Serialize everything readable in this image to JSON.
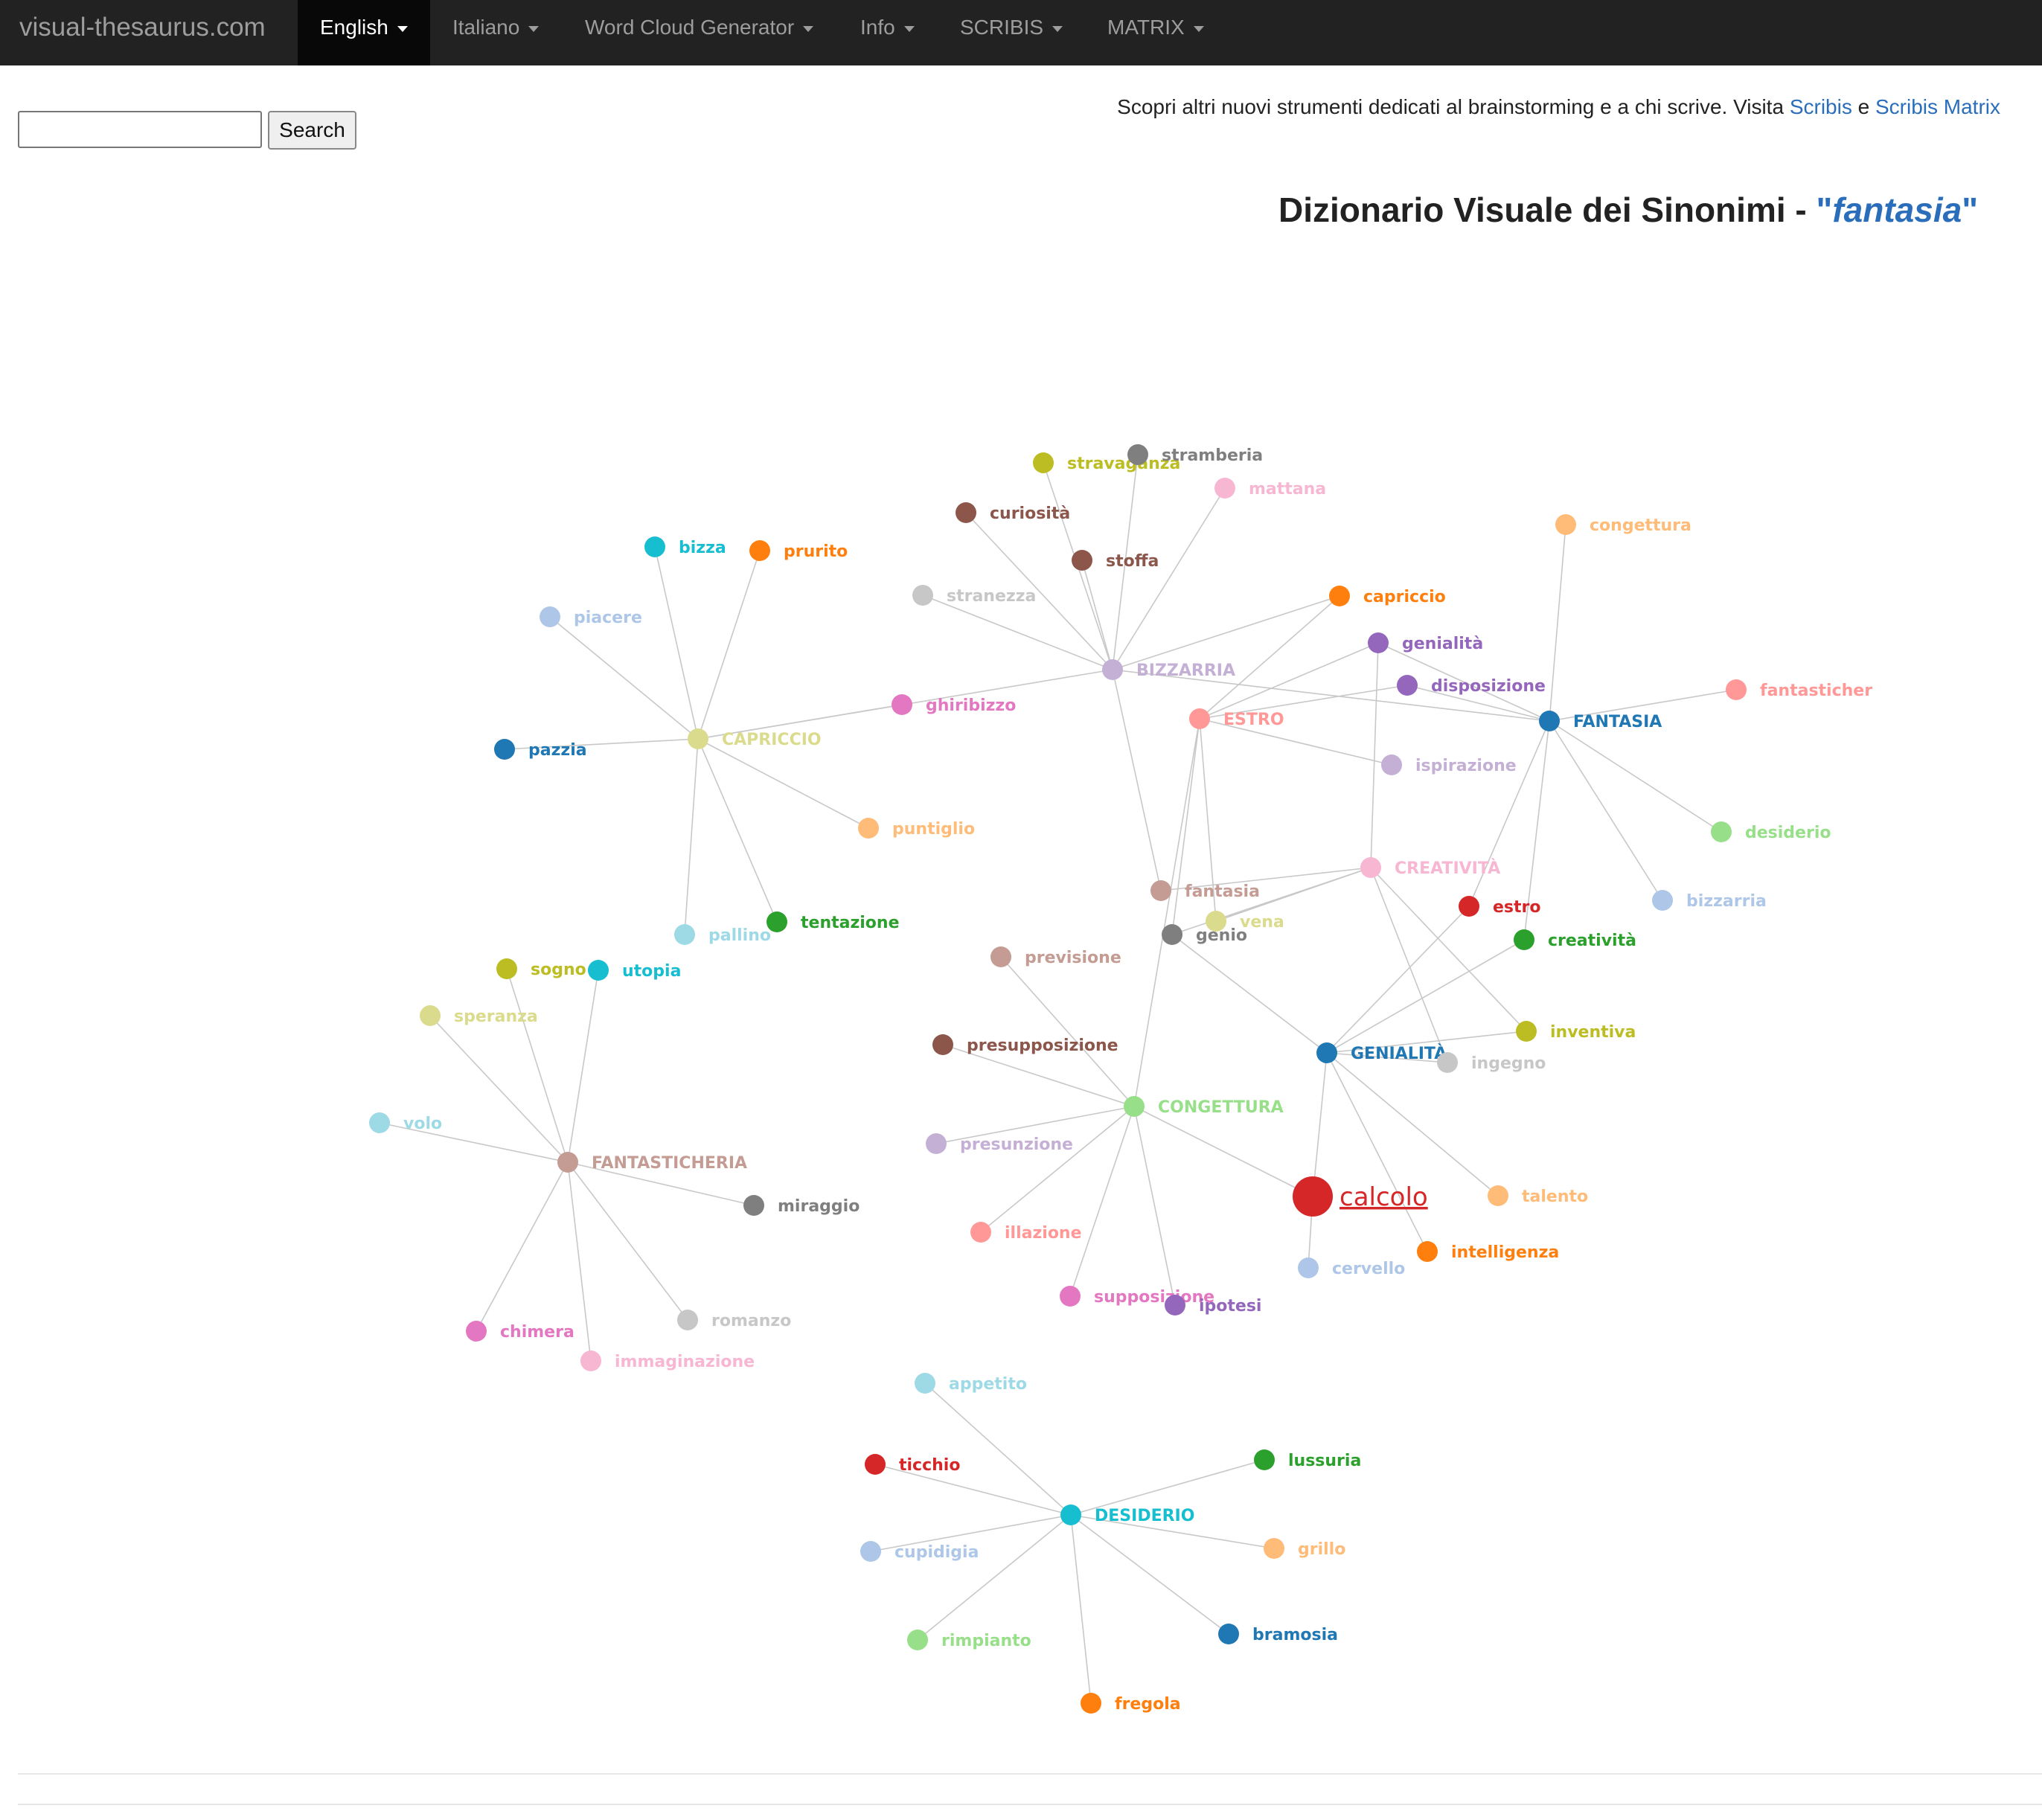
{
  "navbar": {
    "brand": "visual-thesaurus.com",
    "items": [
      {
        "label": "English",
        "active": true
      },
      {
        "label": "Italiano"
      },
      {
        "label": "Word Cloud Generator"
      },
      {
        "label": "Info"
      },
      {
        "label": "SCRIBIS"
      },
      {
        "label": "MATRIX"
      }
    ]
  },
  "search": {
    "value": "",
    "button_label": "Search"
  },
  "promo": {
    "text": "Scopri altri nuovi strumenti dedicati al brainstorming e a chi scrive. Visita",
    "link1": "Scribis",
    "conj": "e",
    "link2": "Scribis Matrix"
  },
  "page_title": {
    "prefix": "Dizionario Visuale dei Sinonimi - ",
    "quote_open": "\"",
    "keyword": "fantasia",
    "quote_close": "\""
  },
  "graph": {
    "nodes": [
      {
        "id": "CAPRICCIO",
        "color": "#dbdb8d",
        "hub": true
      },
      {
        "id": "BIZZARRIA",
        "color": "#c5b0d5",
        "hub": true
      },
      {
        "id": "ESTRO",
        "color": "#ff9896",
        "hub": true
      },
      {
        "id": "FANTASIA",
        "color": "#1f77b4",
        "hub": true
      },
      {
        "id": "CREATIVITÀ",
        "color": "#f7b6d2",
        "hub": true
      },
      {
        "id": "GENIALITÀ",
        "color": "#1f77b4",
        "hub": true
      },
      {
        "id": "CONGETTURA",
        "color": "#98df8a",
        "hub": true
      },
      {
        "id": "FANTASTICHERIA",
        "color": "#c49c94",
        "hub": true
      },
      {
        "id": "DESIDERIO",
        "color": "#17becf",
        "hub": true
      },
      {
        "id": "calcolo",
        "color": "#d62728",
        "center": true
      },
      {
        "id": "stravaganza",
        "color": "#bcbd22"
      },
      {
        "id": "stramberia",
        "color": "#7f7f7f"
      },
      {
        "id": "mattana",
        "color": "#f7b6d2"
      },
      {
        "id": "curiosità",
        "color": "#8c564b"
      },
      {
        "id": "stoffa",
        "color": "#8c564b"
      },
      {
        "id": "stranezza",
        "color": "#c7c7c7"
      },
      {
        "id": "bizza",
        "color": "#17becf"
      },
      {
        "id": "prurito",
        "color": "#ff7f0e"
      },
      {
        "id": "piacere",
        "color": "#aec7e8"
      },
      {
        "id": "ghiribizzo",
        "color": "#e377c2"
      },
      {
        "id": "pazzia",
        "color": "#1f77b4"
      },
      {
        "id": "puntiglio",
        "color": "#ffbb78"
      },
      {
        "id": "pallino",
        "color": "#9edae5"
      },
      {
        "id": "tentazione",
        "color": "#2ca02c"
      },
      {
        "id": "capriccio",
        "color": "#ff7f0e"
      },
      {
        "id": "genialità",
        "color": "#9467bd"
      },
      {
        "id": "disposizione",
        "color": "#9467bd"
      },
      {
        "id": "ispirazione",
        "color": "#c5b0d5"
      },
      {
        "id": "congettura",
        "color": "#ffbb78"
      },
      {
        "id": "fantasticher",
        "color": "#ff9896"
      },
      {
        "id": "desiderio",
        "color": "#98df8a"
      },
      {
        "id": "bizzarria",
        "color": "#aec7e8"
      },
      {
        "id": "estro",
        "color": "#d62728"
      },
      {
        "id": "creatività",
        "color": "#2ca02c"
      },
      {
        "id": "fantasia",
        "color": "#c49c94"
      },
      {
        "id": "vena",
        "color": "#dbdb8d"
      },
      {
        "id": "genio",
        "color": "#7f7f7f"
      },
      {
        "id": "previsione",
        "color": "#c49c94"
      },
      {
        "id": "inventiva",
        "color": "#bcbd22"
      },
      {
        "id": "ingegno",
        "color": "#c7c7c7"
      },
      {
        "id": "presupposizione",
        "color": "#8c564b"
      },
      {
        "id": "presunzione",
        "color": "#c5b0d5"
      },
      {
        "id": "talento",
        "color": "#ffbb78"
      },
      {
        "id": "illazione",
        "color": "#ff9896"
      },
      {
        "id": "intelligenza",
        "color": "#ff7f0e"
      },
      {
        "id": "cervello",
        "color": "#aec7e8"
      },
      {
        "id": "supposizione",
        "color": "#e377c2"
      },
      {
        "id": "ipotesi",
        "color": "#9467bd"
      },
      {
        "id": "sogno",
        "color": "#bcbd22"
      },
      {
        "id": "utopia",
        "color": "#17becf"
      },
      {
        "id": "speranza",
        "color": "#dbdb8d"
      },
      {
        "id": "volo",
        "color": "#9edae5"
      },
      {
        "id": "miraggio",
        "color": "#7f7f7f"
      },
      {
        "id": "chimera",
        "color": "#e377c2"
      },
      {
        "id": "romanzo",
        "color": "#c7c7c7"
      },
      {
        "id": "immaginazione",
        "color": "#f7b6d2"
      },
      {
        "id": "appetito",
        "color": "#9edae5"
      },
      {
        "id": "ticchio",
        "color": "#d62728"
      },
      {
        "id": "lussuria",
        "color": "#2ca02c"
      },
      {
        "id": "cupidigia",
        "color": "#aec7e8"
      },
      {
        "id": "grillo",
        "color": "#ffbb78"
      },
      {
        "id": "rimpianto",
        "color": "#98df8a"
      },
      {
        "id": "bramosia",
        "color": "#1f77b4"
      },
      {
        "id": "fregola",
        "color": "#ff7f0e"
      }
    ],
    "links": [
      [
        "CAPRICCIO",
        "bizza"
      ],
      [
        "CAPRICCIO",
        "prurito"
      ],
      [
        "CAPRICCIO",
        "piacere"
      ],
      [
        "CAPRICCIO",
        "pazzia"
      ],
      [
        "CAPRICCIO",
        "ghiribizzo"
      ],
      [
        "CAPRICCIO",
        "puntiglio"
      ],
      [
        "CAPRICCIO",
        "pallino"
      ],
      [
        "CAPRICCIO",
        "tentazione"
      ],
      [
        "CAPRICCIO",
        "BIZZARRIA"
      ],
      [
        "BIZZARRIA",
        "stravaganza"
      ],
      [
        "BIZZARRIA",
        "stramberia"
      ],
      [
        "BIZZARRIA",
        "mattana"
      ],
      [
        "BIZZARRIA",
        "curiosità"
      ],
      [
        "BIZZARRIA",
        "stoffa"
      ],
      [
        "BIZZARRIA",
        "stranezza"
      ],
      [
        "BIZZARRIA",
        "capriccio"
      ],
      [
        "BIZZARRIA",
        "fantasia"
      ],
      [
        "BIZZARRIA",
        "FANTASIA"
      ],
      [
        "ESTRO",
        "capriccio"
      ],
      [
        "ESTRO",
        "genialità"
      ],
      [
        "ESTRO",
        "disposizione"
      ],
      [
        "ESTRO",
        "ispirazione"
      ],
      [
        "ESTRO",
        "vena"
      ],
      [
        "ESTRO",
        "CONGETTURA"
      ],
      [
        "ESTRO",
        "genio"
      ],
      [
        "FANTASIA",
        "congettura"
      ],
      [
        "FANTASIA",
        "fantasticher"
      ],
      [
        "FANTASIA",
        "desiderio"
      ],
      [
        "FANTASIA",
        "bizzarria"
      ],
      [
        "FANTASIA",
        "estro"
      ],
      [
        "FANTASIA",
        "creatività"
      ],
      [
        "FANTASIA",
        "genialità"
      ],
      [
        "FANTASIA",
        "disposizione"
      ],
      [
        "CREATIVITÀ",
        "genialità"
      ],
      [
        "CREATIVITÀ",
        "fantasia"
      ],
      [
        "CREATIVITÀ",
        "vena"
      ],
      [
        "CREATIVITÀ",
        "genio"
      ],
      [
        "CREATIVITÀ",
        "inventiva"
      ],
      [
        "CREATIVITÀ",
        "ingegno"
      ],
      [
        "GENIALITÀ",
        "estro"
      ],
      [
        "GENIALITÀ",
        "creatività"
      ],
      [
        "GENIALITÀ",
        "inventiva"
      ],
      [
        "GENIALITÀ",
        "ingegno"
      ],
      [
        "GENIALITÀ",
        "talento"
      ],
      [
        "GENIALITÀ",
        "intelligenza"
      ],
      [
        "GENIALITÀ",
        "calcolo"
      ],
      [
        "GENIALITÀ",
        "genio"
      ],
      [
        "CONGETTURA",
        "previsione"
      ],
      [
        "CONGETTURA",
        "presupposizione"
      ],
      [
        "CONGETTURA",
        "presunzione"
      ],
      [
        "CONGETTURA",
        "illazione"
      ],
      [
        "CONGETTURA",
        "supposizione"
      ],
      [
        "CONGETTURA",
        "ipotesi"
      ],
      [
        "CONGETTURA",
        "calcolo"
      ],
      [
        "calcolo",
        "cervello"
      ],
      [
        "FANTASTICHERIA",
        "sogno"
      ],
      [
        "FANTASTICHERIA",
        "utopia"
      ],
      [
        "FANTASTICHERIA",
        "speranza"
      ],
      [
        "FANTASTICHERIA",
        "volo"
      ],
      [
        "FANTASTICHERIA",
        "miraggio"
      ],
      [
        "FANTASTICHERIA",
        "chimera"
      ],
      [
        "FANTASTICHERIA",
        "romanzo"
      ],
      [
        "FANTASTICHERIA",
        "immaginazione"
      ],
      [
        "DESIDERIO",
        "appetito"
      ],
      [
        "DESIDERIO",
        "ticchio"
      ],
      [
        "DESIDERIO",
        "lussuria"
      ],
      [
        "DESIDERIO",
        "cupidigia"
      ],
      [
        "DESIDERIO",
        "grillo"
      ],
      [
        "DESIDERIO",
        "rimpianto"
      ],
      [
        "DESIDERIO",
        "bramosia"
      ],
      [
        "DESIDERIO",
        "fregola"
      ]
    ]
  }
}
